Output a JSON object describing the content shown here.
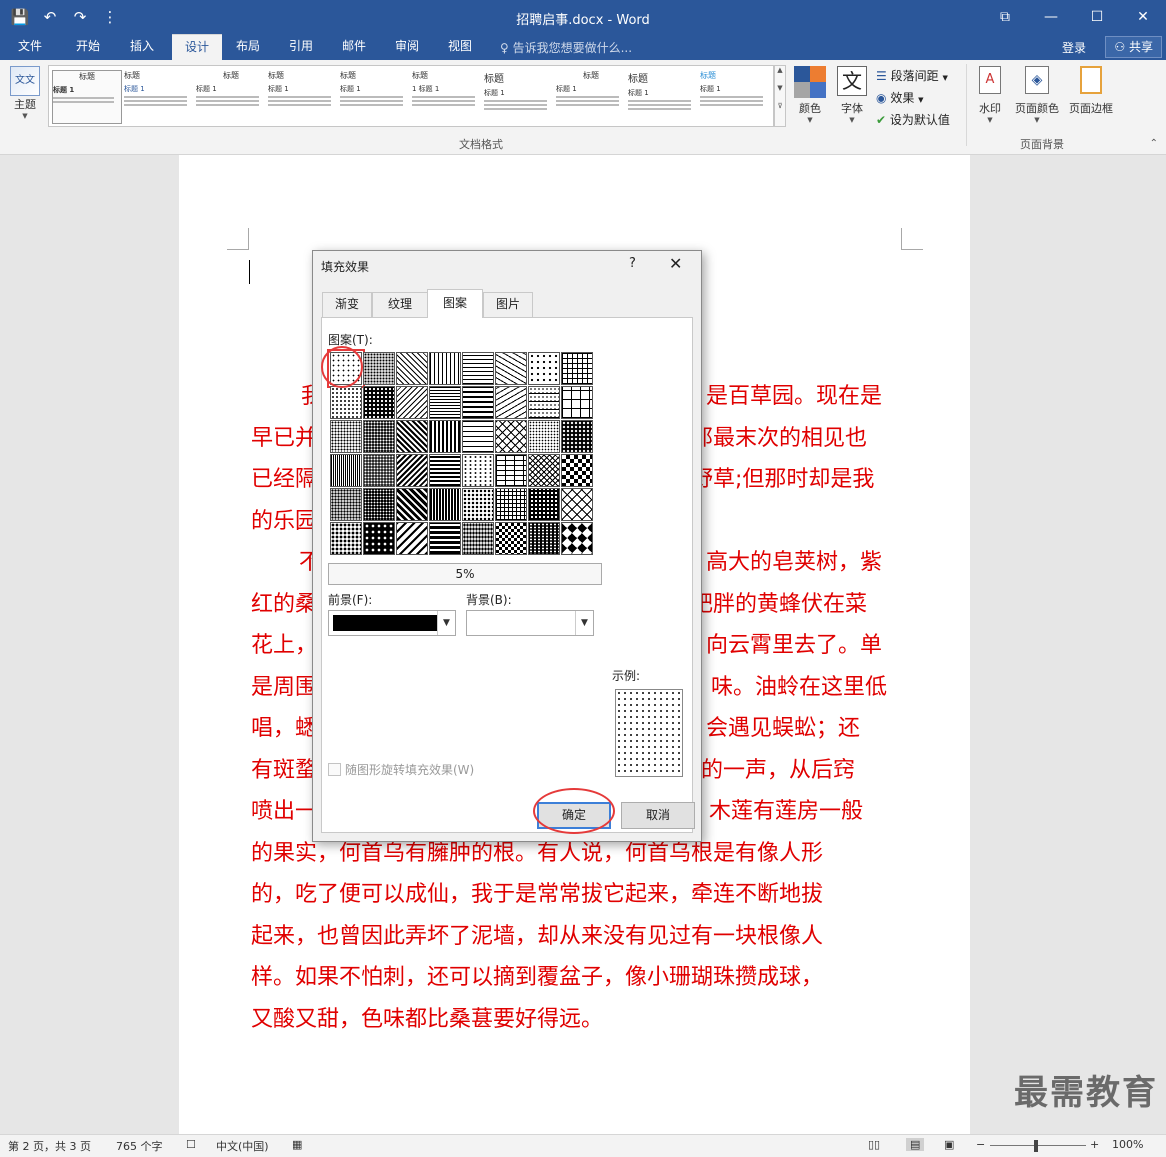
{
  "window": {
    "title": "招聘启事.docx - Word"
  },
  "qat": {
    "save": "💾",
    "undo": "↶",
    "redo": "↷",
    "customize": "⋮"
  },
  "tabs": [
    "文件",
    "开始",
    "插入",
    "设计",
    "布局",
    "引用",
    "邮件",
    "审阅",
    "视图"
  ],
  "active_tab": "设计",
  "tell_me": "告诉我您想要做什么...",
  "account": {
    "login": "登录",
    "share": "共享"
  },
  "ribbon": {
    "theme_label": "主题",
    "style_items": [
      {
        "title": "标题",
        "heading": "标题 1"
      },
      {
        "title": "标题",
        "heading": "标题 1"
      },
      {
        "title": "标题",
        "heading": "标题 1"
      },
      {
        "title": "标题",
        "heading": "标题 1"
      },
      {
        "title": "标题",
        "heading": "标题 1"
      },
      {
        "title": "标题",
        "heading": "1 标题 1"
      },
      {
        "title": "标题",
        "heading": "标题 1"
      },
      {
        "title": "标题",
        "heading": "标题 1"
      },
      {
        "title": "标题",
        "heading": "标题 1"
      },
      {
        "title": "标题",
        "heading": "标题 1"
      }
    ],
    "colors_label": "颜色",
    "fonts_label": "字体",
    "paragraph_spacing": "段落间距",
    "effects": "效果",
    "set_default": "设为默认值",
    "watermark": "水印",
    "page_color": "页面颜色",
    "page_borders": "页面边框",
    "group_doc_format": "文档格式",
    "group_page_bg": "页面背景"
  },
  "document": {
    "lines": [
      {
        "left": "我",
        "right": "是百草园。现在是"
      },
      {
        "left": "早已并",
        "right": "那最末次的相见也"
      },
      {
        "left": "已经隔",
        "right": "野草;但那时却是我"
      },
      {
        "left": "的乐园",
        "right": ""
      },
      {
        "left": "　不",
        "right": "高大的皂荚树，紫"
      },
      {
        "left": "红的桑",
        "right": "肥胖的黄蜂伏在菜"
      },
      {
        "left": "花上，",
        "right": "向云霄里去了。单"
      },
      {
        "left": "是周围",
        "right": "味。油蛉在这里低"
      },
      {
        "left": "唱，蟋",
        "right": "会遇见蜈蚣；还"
      },
      {
        "left": "有斑蝥",
        "right": "的一声，从后窍"
      },
      {
        "left": "喷出一",
        "right": "木莲有莲房一般"
      },
      {
        "left": "的果实，何首乌有臃肿的根。有人说，何首乌根是有像人形",
        "right": ""
      },
      {
        "left": "的，吃了便可以成仙，我于是常常拔它起来，牵连不断地拔",
        "right": ""
      },
      {
        "left": "起来，也曾因此弄坏了泥墙，却从来没有见过有一块根像人",
        "right": ""
      },
      {
        "left": "样。如果不怕刺，还可以摘到覆盆子，像小珊瑚珠攒成球，",
        "right": ""
      },
      {
        "left": "又酸又甜，色味都比桑葚要好得远。",
        "right": ""
      }
    ]
  },
  "dialog": {
    "title": "填充效果",
    "help": "?",
    "close": "✕",
    "tabs": [
      "渐变",
      "纹理",
      "图案",
      "图片"
    ],
    "active_tab": "图案",
    "pattern_label": "图案(T):",
    "selected_pattern": "5%",
    "foreground_label": "前景(F):",
    "background_label": "背景(B):",
    "foreground_color": "#000000",
    "sample_label": "示例:",
    "rotate_checkbox": "随图形旋转填充效果(W)",
    "ok": "确定",
    "cancel": "取消"
  },
  "statusbar": {
    "page": "第 2 页，共 3 页",
    "words": "765 个字",
    "language": "中文(中国)",
    "zoom": "100%"
  },
  "brand_watermark": "最需教育"
}
